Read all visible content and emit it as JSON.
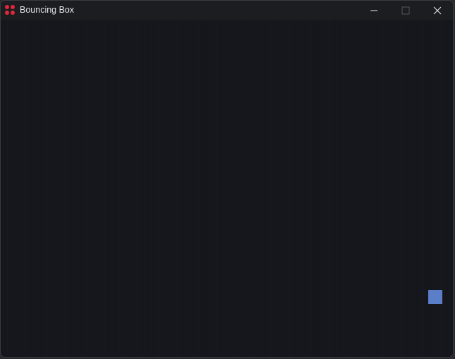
{
  "window": {
    "title": "Bouncing Box",
    "icon": "four-dots-app-icon",
    "controls": {
      "minimize_icon": "minimize-icon",
      "maximize_icon": "maximize-icon",
      "maximize_enabled": false,
      "close_icon": "close-icon"
    }
  },
  "canvas": {
    "background_color": "#15161b",
    "box": {
      "color": "#5b7ec8"
    }
  },
  "colors": {
    "titlebar": "#1c1d21",
    "title_text": "#e6e6e8",
    "app_icon": "#e0283a"
  }
}
